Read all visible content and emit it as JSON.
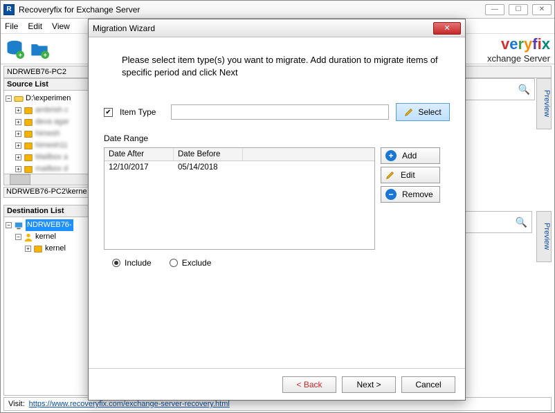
{
  "app": {
    "title": "Recoveryfix for Exchange Server",
    "icon_letter": "R"
  },
  "menubar": [
    "File",
    "Edit",
    "View"
  ],
  "brand": {
    "logo_fragment": "veryfix",
    "subtitle_fragment": "xchange Server"
  },
  "crumb1": "NDRWEB76-PC2",
  "crumb2": "NDRWEB76-PC2\\kerne",
  "source_list": {
    "title": "Source List",
    "root": "D:\\experimen",
    "items": [
      "(blurred)",
      "(blurred)",
      "(blurred)",
      "(blurred)",
      "(blurred)",
      "(blurred)"
    ]
  },
  "destination_list": {
    "title": "Destination List",
    "root": "NDRWEB76-",
    "child1": "kernel",
    "child2": "kernel"
  },
  "preview_tab": "Preview",
  "footer": {
    "label": "Visit:",
    "url": "https://www.recoveryfix.com/exchange-server-recovery.html"
  },
  "dialog": {
    "title": "Migration Wizard",
    "instruction": "Please select item type(s) you want to migrate. Add duration to migrate items of specific period and click Next",
    "item_type_checked": true,
    "item_type_label": "Item Type",
    "item_type_value": "",
    "select_btn": "Select",
    "date_range_label": "Date Range",
    "table": {
      "headers": [
        "Date After",
        "Date Before"
      ],
      "rows": [
        {
          "after": "12/10/2017",
          "before": "05/14/2018"
        }
      ]
    },
    "side_buttons": {
      "add": "Add",
      "edit": "Edit",
      "remove": "Remove"
    },
    "radios": {
      "include": "Include",
      "exclude": "Exclude",
      "selected": "include"
    },
    "footer": {
      "back": "< Back",
      "next": "Next >",
      "cancel": "Cancel"
    }
  }
}
